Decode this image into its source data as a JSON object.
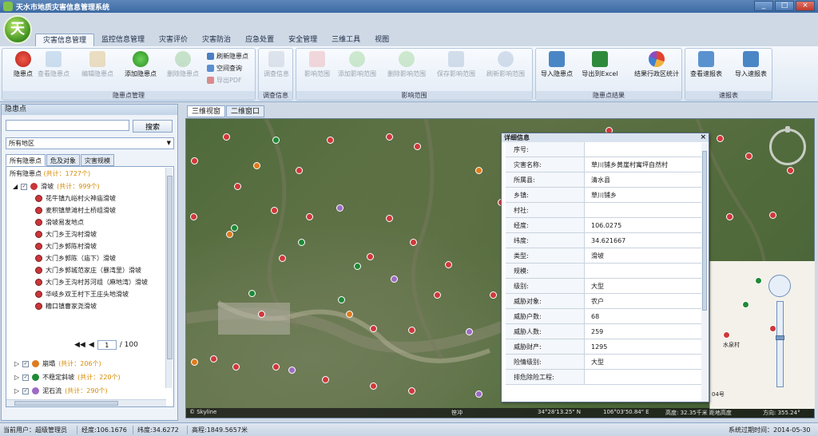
{
  "window": {
    "title": "天水市地质灾害信息管理系统",
    "logo_char": "天",
    "controls": [
      "_",
      "□",
      "×"
    ]
  },
  "tabs": [
    "灾害信息管理",
    "监控信息管理",
    "灾害评价",
    "灾害防治",
    "应急处置",
    "安全管理",
    "三维工具",
    "视图"
  ],
  "ribbon": {
    "g1": {
      "title": "隐患点管理",
      "btn_hazard": "隐患点",
      "btn_view": "查看隐患点",
      "btn_edit": "编辑隐患点",
      "btn_add": "添加隐患点",
      "btn_del": "删除隐患点",
      "s_refresh": "刷新隐患点",
      "s_query": "空间查询",
      "s_pdf": "导出PDF"
    },
    "g2": {
      "title": "调查信息",
      "btn": "调查信息"
    },
    "g3": {
      "title": "影响范围",
      "b1": "影响范围",
      "b2": "添加影响范围",
      "b3": "删除影响范围",
      "b4": "保存影响范围",
      "b5": "刷新影响范围"
    },
    "g4": {
      "title": "隐患点结果",
      "b1": "导入隐患点",
      "b2": "导出到Excel",
      "b3": "结果行政区统计"
    },
    "g5": {
      "title": "速报表",
      "b1": "查看速报表",
      "b2": "导入速报表"
    }
  },
  "left": {
    "header": "隐患点",
    "search_placeholder": "",
    "search_button": "搜索",
    "region": "所有地区",
    "subtabs": [
      "所有隐患点",
      "危及对象",
      "灾害规模"
    ],
    "root_label": "所有隐患点",
    "root_count": "(共计：1727个)",
    "landslide": {
      "label": "滑坡",
      "count": "(共计：999个)"
    },
    "leaves": [
      "花牛镇九峪村火神庙滑坡",
      "麦积镇草滩村土桥组滑坡",
      "滑坡易发地点",
      "大门乡王沟村滑坡",
      "大门乡郭陈村滑坡",
      "大门乡郭陈（庙下）滑坡",
      "大门乡郭城范家庄（暴湾里）滑坡",
      "大门乡王沟村苏河组（麻地湾）滑坡",
      "华岐乡双王村下王庄头地滑坡",
      "糟口镇曹家尧滑坡"
    ],
    "pager": {
      "prev": "◀◀",
      "prev2": "◀",
      "page": "1",
      "total": "/ 100"
    },
    "lower": [
      {
        "label": "崩塌",
        "count": "(共计：206个)"
      },
      {
        "label": "不稳定斜坡",
        "count": "(共计：220个)"
      },
      {
        "label": "泥石流",
        "count": "(共计：290个)"
      }
    ]
  },
  "view_tabs": [
    "三维视窗",
    "二维窗口"
  ],
  "detail": {
    "title": "详细信息",
    "close": "×",
    "rows": [
      {
        "k": "序号:",
        "v": ""
      },
      {
        "k": "灾害名称:",
        "v": "草川铺乡黄崖村寓坪自然村"
      },
      {
        "k": "所属县:",
        "v": "清水县"
      },
      {
        "k": "乡镇:",
        "v": "草川铺乡"
      },
      {
        "k": "村社:",
        "v": ""
      },
      {
        "k": "经度:",
        "v": "106.0275"
      },
      {
        "k": "纬度:",
        "v": "34.621667"
      },
      {
        "k": "类型:",
        "v": "滑坡"
      },
      {
        "k": "规模:",
        "v": ""
      },
      {
        "k": "级别:",
        "v": "大型"
      },
      {
        "k": "威胁对象:",
        "v": "农户"
      },
      {
        "k": "威胁户数:",
        "v": "68"
      },
      {
        "k": "威胁人数:",
        "v": "259"
      },
      {
        "k": "威胁财产:",
        "v": "1295"
      },
      {
        "k": "险情级别:",
        "v": "大型"
      },
      {
        "k": "排危除险工程:",
        "v": ""
      }
    ]
  },
  "map2d": {
    "place": "水泉村",
    "scale_tail": "04号"
  },
  "map_status": {
    "brand": "© Skyline",
    "place": "笹冲",
    "lat": "34°28'13.25\" N",
    "lon": "106°03'50.84\" E",
    "alt": "高度: 32.35千米 距地高度",
    "heading": "方向: 355.24°"
  },
  "statusbar": {
    "user": "当前用户：超级管理员",
    "lon": "经度:106.1676",
    "lat": "纬度:34.6272",
    "elev": "高程:1849.5657米",
    "expire": "系统过期时间：2014-05-30"
  }
}
